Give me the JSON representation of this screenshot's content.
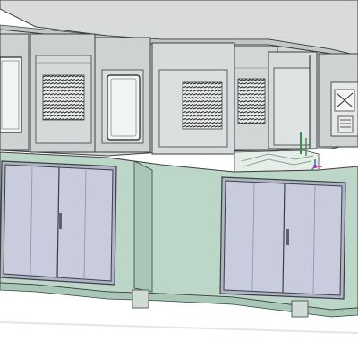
{
  "viewport": {
    "background": "#ffffff",
    "colors": {
      "upper_panel": "#d3d6d6",
      "upper_panel_dark": "#b9bebe",
      "base_green": "#bcd6c8",
      "base_green_dark": "#a7c6b5",
      "door": "#c9ccdc",
      "door_dark": "#aeb3c8",
      "edge": "#3c4040",
      "louver": "#2a2d2d"
    },
    "icons": [
      "louver-vent",
      "door-handle",
      "axis-triad"
    ]
  }
}
